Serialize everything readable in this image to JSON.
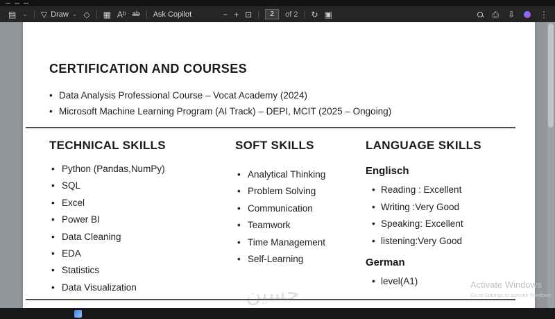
{
  "toolbar": {
    "icons": {
      "panel": "▤",
      "caret": "⌄",
      "draw_glyph": "▽",
      "eraser": "◇",
      "text_grid": "▦",
      "read_aloud": "Aᵇ",
      "text_strike": "ab",
      "zoom_out": "−",
      "zoom_in": "+",
      "fit": "⊡",
      "rotate": "↻",
      "pages": "▣",
      "print": "⎙",
      "save": "⇩",
      "more": "⋮"
    },
    "draw_label": "Draw",
    "ask_copilot_label": "Ask Copilot",
    "page_current": "2",
    "page_total_label": "of 2"
  },
  "resume": {
    "certification": {
      "title": "CERTIFICATION AND COURSES",
      "items": [
        "Data Analysis Professional Course – Vocat Academy (2024)",
        "Microsoft Machine Learning Program (AI Track) – DEPI, MCIT (2025 – Ongoing)"
      ]
    },
    "technical": {
      "title": "TECHNICAL SKILLS",
      "items": [
        "Python (Pandas,NumPy)",
        "SQL",
        "Excel",
        "Power BI",
        "Data Cleaning",
        "EDA",
        "Statistics",
        "Data Visualization"
      ]
    },
    "soft": {
      "title": "SOFT SKILLS",
      "items": [
        "Analytical Thinking",
        "Problem Solving",
        "Communication",
        "Teamwork",
        "Time Management",
        "Self-Learning"
      ]
    },
    "language": {
      "title": "LANGUAGE SKILLS",
      "groups": [
        {
          "name": "Englisch",
          "items": [
            "Reading : Excellent",
            "Writing :Very Good",
            "Speaking: Excellent",
            "listening:Very Good"
          ]
        },
        {
          "name": "German",
          "items": [
            "level(A1)"
          ]
        }
      ]
    }
  },
  "watermarks": {
    "activate_line1": "Activate Windows",
    "activate_line2": "Go to Settings to activate Windows",
    "site": "حسين"
  }
}
